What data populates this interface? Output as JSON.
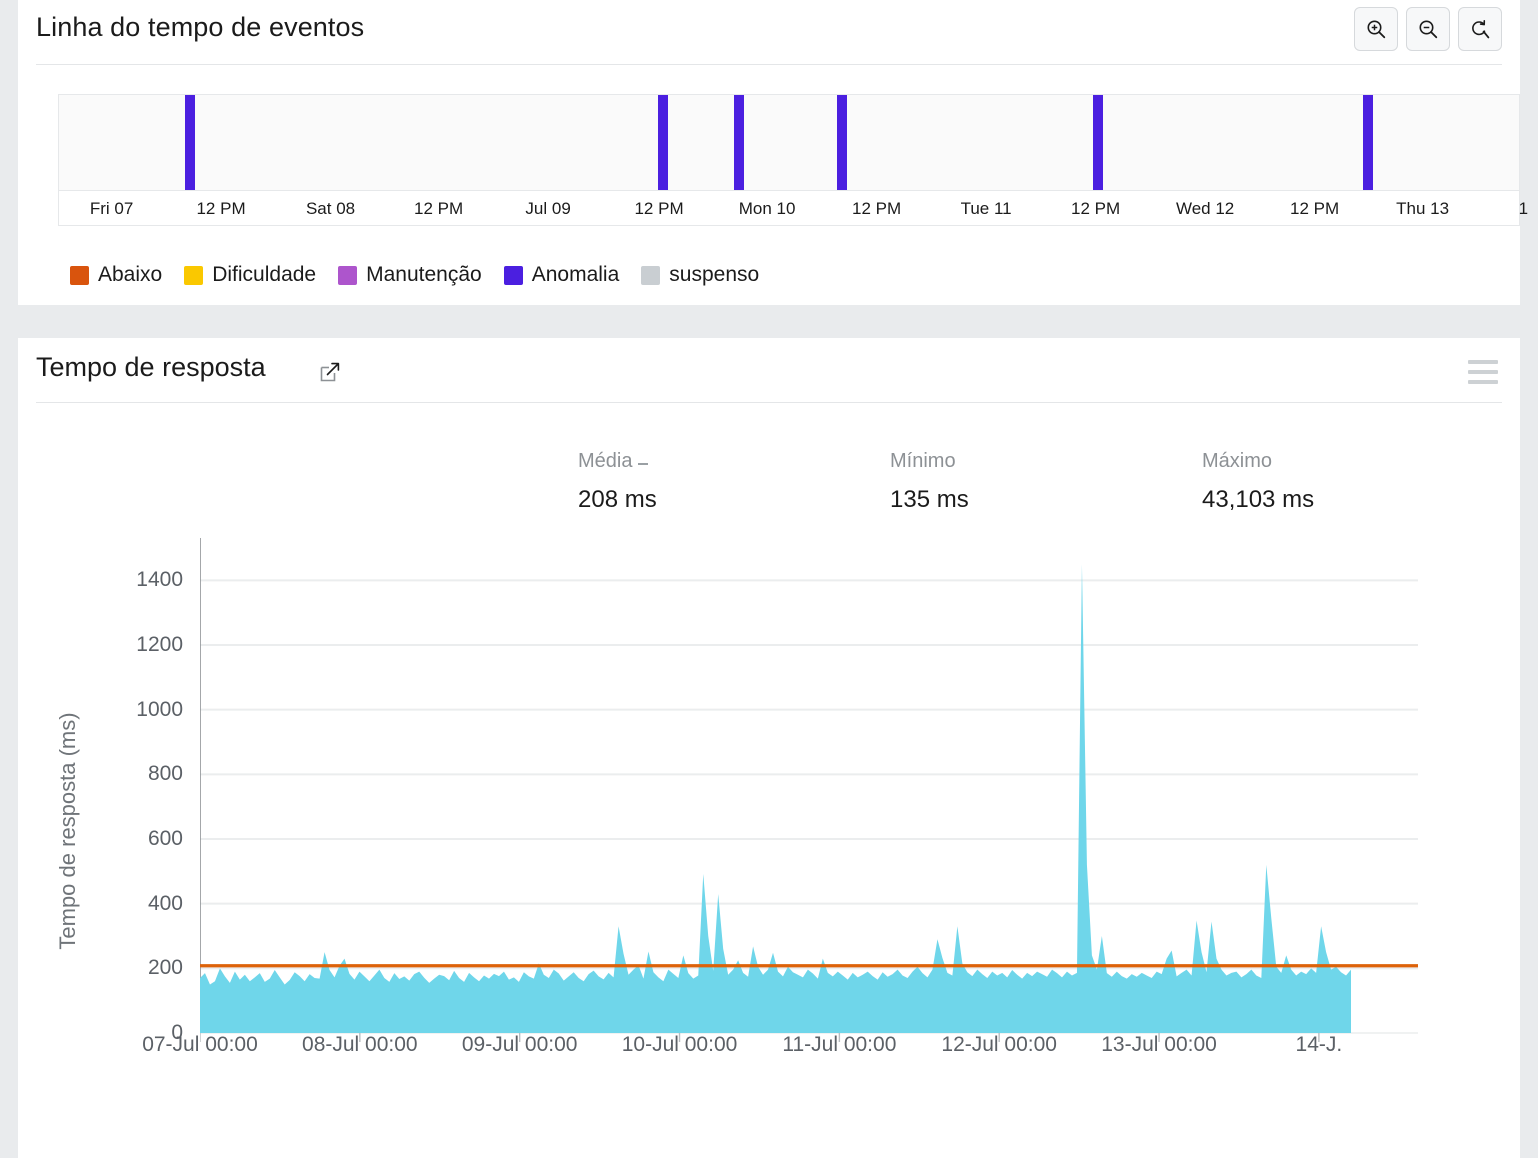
{
  "timeline_panel": {
    "title": "Linha do tempo de eventos",
    "controls": [
      {
        "name": "zoom-in-button",
        "icon": "zoom-in-icon"
      },
      {
        "name": "zoom-out-button",
        "icon": "zoom-out-icon"
      },
      {
        "name": "zoom-reset-button",
        "icon": "zoom-reset-icon"
      }
    ],
    "axis_ticks": [
      {
        "label": "Fri 07",
        "x_pct": 3.6
      },
      {
        "label": "12 PM",
        "x_pct": 11.1
      },
      {
        "label": "Sat 08",
        "x_pct": 18.6
      },
      {
        "label": "12 PM",
        "x_pct": 26.0
      },
      {
        "label": "Jul 09",
        "x_pct": 33.5
      },
      {
        "label": "12 PM",
        "x_pct": 41.1
      },
      {
        "label": "Mon 10",
        "x_pct": 48.5
      },
      {
        "label": "12 PM",
        "x_pct": 56.0
      },
      {
        "label": "Tue 11",
        "x_pct": 63.5
      },
      {
        "label": "12 PM",
        "x_pct": 71.0
      },
      {
        "label": "Wed 12",
        "x_pct": 78.5
      },
      {
        "label": "12 PM",
        "x_pct": 86.0
      },
      {
        "label": "Thu 13",
        "x_pct": 93.4
      },
      {
        "label": "1",
        "x_pct": 100.3
      }
    ],
    "events": [
      {
        "category": "Anomalia",
        "x_pct": 8.6
      },
      {
        "category": "Anomalia",
        "x_pct": 41.0
      },
      {
        "category": "Anomalia",
        "x_pct": 46.2
      },
      {
        "category": "Anomalia",
        "x_pct": 53.3
      },
      {
        "category": "Anomalia",
        "x_pct": 70.8
      },
      {
        "category": "Anomalia",
        "x_pct": 89.3
      }
    ],
    "legend": [
      {
        "label": "Abaixo",
        "color": "#d9540d"
      },
      {
        "label": "Dificuldade",
        "color": "#fac800"
      },
      {
        "label": "Manutenção",
        "color": "#ad55cc"
      },
      {
        "label": "Anomalia",
        "color": "#4b1fe0"
      },
      {
        "label": "suspenso",
        "color": "#c9ced2"
      }
    ]
  },
  "response_panel": {
    "title": "Tempo de resposta",
    "external_link_icon": "external-link-icon",
    "menu_icon": "hamburger-menu-icon",
    "stats": [
      {
        "label": "Média",
        "value": "208 ms"
      },
      {
        "label": "Mínimo",
        "value": "135 ms"
      },
      {
        "label": "Máximo",
        "value": "43,103 ms"
      }
    ]
  },
  "chart_data": {
    "type": "area",
    "title": "Tempo de resposta",
    "xlabel": "",
    "ylabel": "Tempo de resposta (ms)",
    "ylim": [
      0,
      1500
    ],
    "yticks": [
      0,
      200,
      400,
      600,
      800,
      1000,
      1200,
      1400
    ],
    "xticks": [
      "07-Jul 00:00",
      "08-Jul 00:00",
      "09-Jul 00:00",
      "10-Jul 00:00",
      "11-Jul 00:00",
      "12-Jul 00:00",
      "13-Jul 00:00",
      "14-J."
    ],
    "grid": true,
    "legend_position": "none",
    "series": [
      {
        "name": "Tempo de resposta",
        "color": "#6fd6ea",
        "fill": true,
        "x_unit": "hours from 07-Jul 00:00",
        "values": [
          170,
          185,
          150,
          160,
          200,
          175,
          155,
          190,
          165,
          180,
          160,
          172,
          185,
          158,
          168,
          195,
          172,
          150,
          164,
          188,
          176,
          160,
          182,
          170,
          168,
          250,
          195,
          172,
          208,
          230,
          183,
          165,
          190,
          175,
          160,
          178,
          196,
          170,
          158,
          185,
          167,
          175,
          162,
          182,
          190,
          171,
          155,
          168,
          180,
          176,
          163,
          192,
          170,
          158,
          186,
          172,
          160,
          178,
          168,
          183,
          176,
          190,
          165,
          172,
          158,
          188,
          175,
          168,
          215,
          180,
          170,
          196,
          184,
          162,
          175,
          188,
          170,
          160,
          182,
          193,
          175,
          166,
          186,
          172,
          330,
          245,
          180,
          196,
          210,
          168,
          252,
          188,
          172,
          160,
          196,
          183,
          170,
          240,
          185,
          168,
          178,
          492,
          300,
          192,
          430,
          260,
          180,
          196,
          225,
          186,
          174,
          268,
          205,
          180,
          196,
          248,
          190,
          175,
          205,
          188,
          180,
          172,
          196,
          184,
          168,
          230,
          186,
          175,
          190,
          178,
          165,
          186,
          172,
          180,
          190,
          176,
          165,
          188,
          174,
          182,
          196,
          178,
          170,
          190,
          205,
          185,
          172,
          196,
          290,
          232,
          186,
          178,
          330,
          215,
          188,
          176,
          196,
          182,
          170,
          190,
          178,
          186,
          172,
          195,
          180,
          168,
          186,
          176,
          190,
          182,
          174,
          196,
          185,
          172,
          190,
          178,
          186,
          1450,
          520,
          240,
          196,
          300,
          185,
          174,
          190,
          176,
          168,
          182,
          174,
          186,
          178,
          170,
          190,
          182,
          230,
          255,
          175,
          186,
          196,
          178,
          348,
          250,
          188,
          345,
          230,
          196,
          178,
          186,
          190,
          172,
          182,
          196,
          178,
          170,
          520,
          355,
          205,
          186,
          240,
          196,
          178,
          190,
          182,
          200,
          186,
          330,
          250,
          196,
          205,
          188,
          178,
          196
        ]
      }
    ],
    "threshold_line": {
      "label": "Média",
      "value": 208,
      "color": "#dd6209"
    },
    "data_end_x_pct": 94.5
  }
}
